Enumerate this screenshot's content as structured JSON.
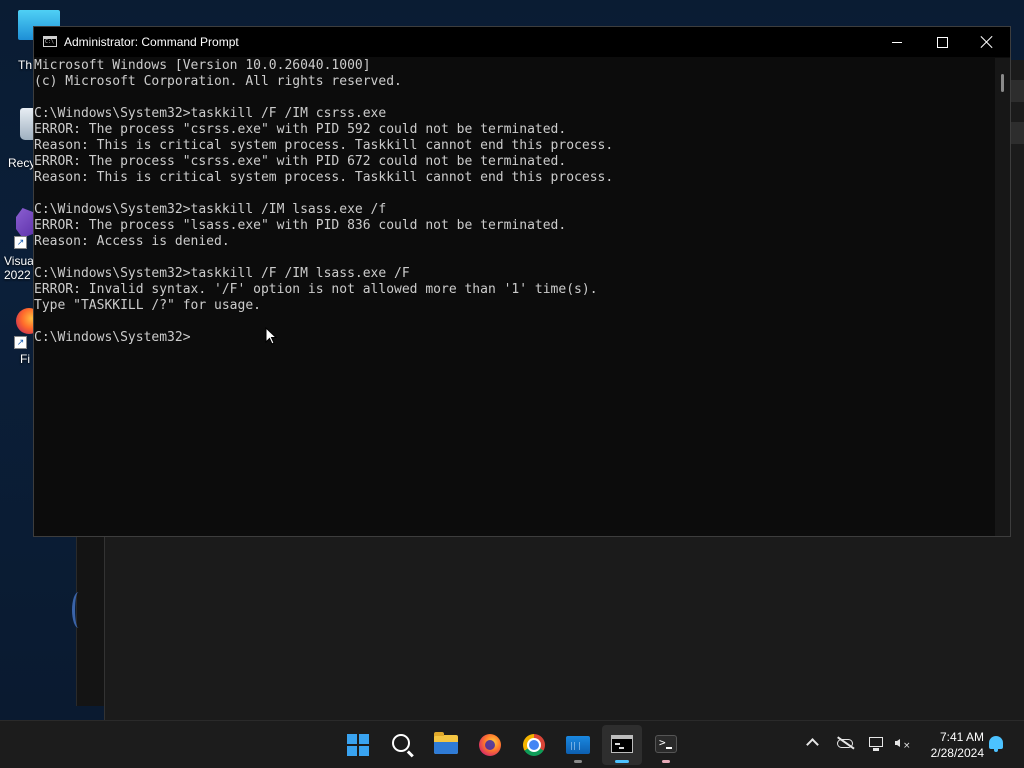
{
  "desktop": {
    "icons": [
      {
        "label": "Th",
        "icon": "this-pc-icon"
      },
      {
        "label": "Recy",
        "icon": "recycle-bin-icon"
      },
      {
        "label": "Visua",
        "label2": "2022",
        "icon": "visual-studio-icon"
      },
      {
        "label": "Fi",
        "icon": "firefox-icon"
      }
    ]
  },
  "window": {
    "title": "Administrator: Command Prompt",
    "minimize_glyph": "—",
    "console_lines": [
      "Microsoft Windows [Version 10.0.26040.1000]",
      "(c) Microsoft Corporation. All rights reserved.",
      "",
      "C:\\Windows\\System32>taskkill /F /IM csrss.exe",
      "ERROR: The process \"csrss.exe\" with PID 592 could not be terminated.",
      "Reason: This is critical system process. Taskkill cannot end this process.",
      "ERROR: The process \"csrss.exe\" with PID 672 could not be terminated.",
      "Reason: This is critical system process. Taskkill cannot end this process.",
      "",
      "C:\\Windows\\System32>taskkill /IM lsass.exe /f",
      "ERROR: The process \"lsass.exe\" with PID 836 could not be terminated.",
      "Reason: Access is denied.",
      "",
      "C:\\Windows\\System32>taskkill /F /IM lsass.exe /F",
      "ERROR: Invalid syntax. '/F' option is not allowed more than '1' time(s).",
      "Type \"TASKKILL /?\" for usage.",
      "",
      "C:\\Windows\\System32>"
    ]
  },
  "taskbar": {
    "items": [
      {
        "name": "start-button",
        "icon": "windows-start-icon"
      },
      {
        "name": "search-button",
        "icon": "search-icon"
      },
      {
        "name": "file-explorer",
        "icon": "folder-icon"
      },
      {
        "name": "firefox",
        "icon": "firefox-icon"
      },
      {
        "name": "chrome",
        "icon": "chrome-icon"
      },
      {
        "name": "resource-monitor",
        "icon": "monitor-icon"
      },
      {
        "name": "command-prompt",
        "icon": "cmd-icon",
        "active": true
      },
      {
        "name": "terminal",
        "icon": "terminal-icon"
      }
    ],
    "tray": {
      "time": "7:41 AM",
      "date": "2/28/2024"
    }
  },
  "colors": {
    "console_bg": "#0c0c0c",
    "console_text": "#cccccc",
    "taskbar_bg": "#1c1c1c",
    "accent": "#4cc2ff"
  }
}
